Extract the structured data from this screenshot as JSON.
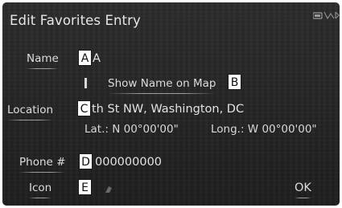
{
  "screen": {
    "title": "Edit Favorites Entry",
    "status_icons": [
      "signal-icon",
      "bluetooth-icon"
    ]
  },
  "fields": {
    "name": {
      "button_label": "Name",
      "value": "A",
      "callout": "A"
    },
    "show_name_on_map": {
      "button_label": "Show Name on Map",
      "callout": "B"
    },
    "location": {
      "button_label": "Location",
      "value": "th St NW, Washington, DC",
      "lat": "Lat.: N 00°00'00\"",
      "long": "Long.: W 00°00'00\"",
      "callout": "C"
    },
    "phone": {
      "button_label": "Phone #",
      "value": "000000000",
      "callout": "D"
    },
    "icon": {
      "button_label": "Icon",
      "callout": "E"
    }
  },
  "actions": {
    "ok_label": "OK"
  }
}
